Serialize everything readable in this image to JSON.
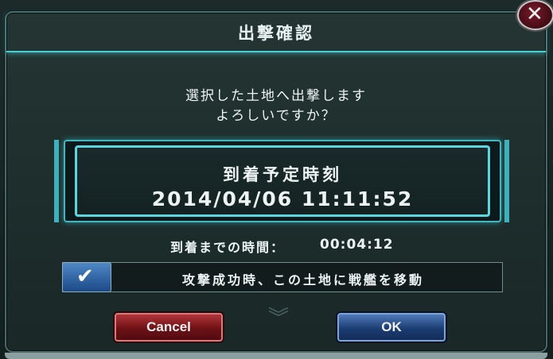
{
  "dialog": {
    "title": "出撃確認",
    "message_line1": "選択した土地へ出撃します",
    "message_line2": "よろしいですか？",
    "arrival_label": "到着予定時刻",
    "arrival_time": "2014/04/06 11:11:52",
    "remaining_label": "到着までの時間：",
    "remaining_value": "00:04:12",
    "option_label": "攻撃成功時、この土地に戦艦を移動",
    "option_checked": true,
    "cancel_label": "Cancel",
    "ok_label": "OK"
  },
  "icons": {
    "close": "close-icon",
    "check": "check-icon",
    "chevron": "chevron-down-icon"
  },
  "colors": {
    "accent": "#48d0d6",
    "cancel": "#8a1a1f",
    "ok": "#23467f",
    "checkbox": "#2f65a8"
  }
}
